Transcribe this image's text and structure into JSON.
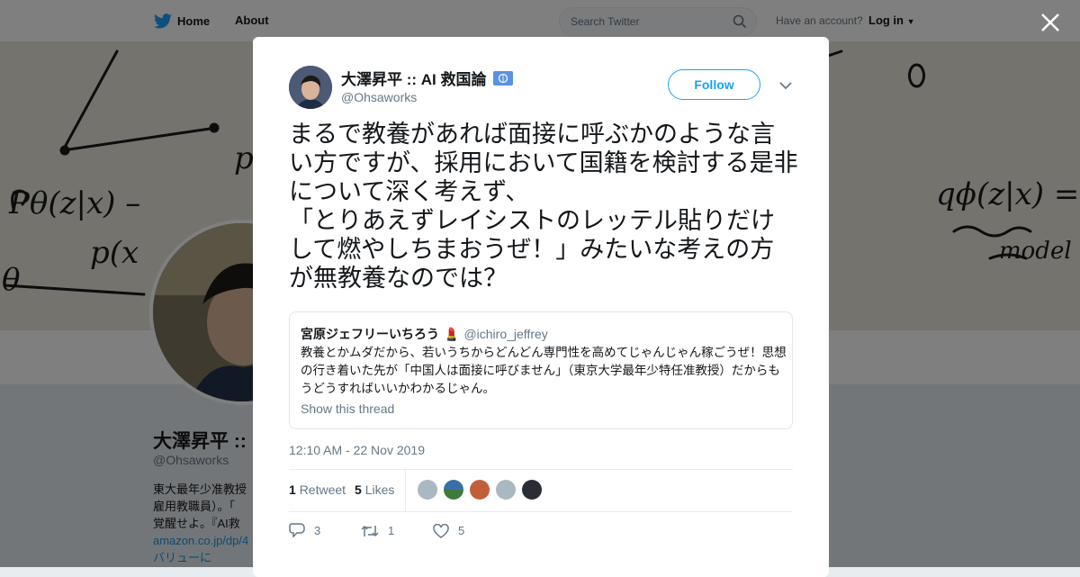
{
  "topbar": {
    "home_label": "Home",
    "about_label": "About",
    "search_placeholder": "Search Twitter",
    "have_account": "Have an account?",
    "login_label": "Log in"
  },
  "profile": {
    "name": "大澤昇平 ::",
    "handle": "@Ohsaworks",
    "bio_line1": "東大最年少准教授",
    "bio_line2": "雇用教職員）。「",
    "bio_line3": "覚醒せよ。『AI救",
    "bio_link": "amazon.co.jp/dp/4",
    "bio_line5": "バリューに"
  },
  "tweet": {
    "author_name": "大澤昇平 :: AI 救国論",
    "author_handle": "@Ohsaworks",
    "follow_label": "Follow",
    "text": "まるで教養があれば面接に呼ぶかのような言い方ですが、採用において国籍を検討する是非について深く考えず、\n「とりあえずレイシストのレッテル貼りだけして燃やしちまおうぜ！」みたいな考えの方が無教養なのでは？",
    "quote": {
      "name": "宮原ジェフリーいちろう",
      "handle": "@ichiro_jeffrey",
      "text": "教養とかムダだから、若いうちからどんどん専門性を高めてじゃんじゃん稼ごうぜ！思想の行き着いた先が「中国人は面接に呼びません」（東京大学最年少特任准教授）だからもうどうすればいいかわかるじゃん。",
      "show_thread": "Show this thread"
    },
    "timestamp": "12:10 AM - 22 Nov 2019",
    "retweet_count": "1",
    "retweet_label": "Retweet",
    "like_count": "5",
    "like_label": "Likes",
    "actions": {
      "reply_count": "3",
      "retweet_count": "1",
      "like_count": "5"
    }
  },
  "colors": {
    "accent": "#1da1f2",
    "text": "#14171a",
    "muted": "#657786"
  }
}
